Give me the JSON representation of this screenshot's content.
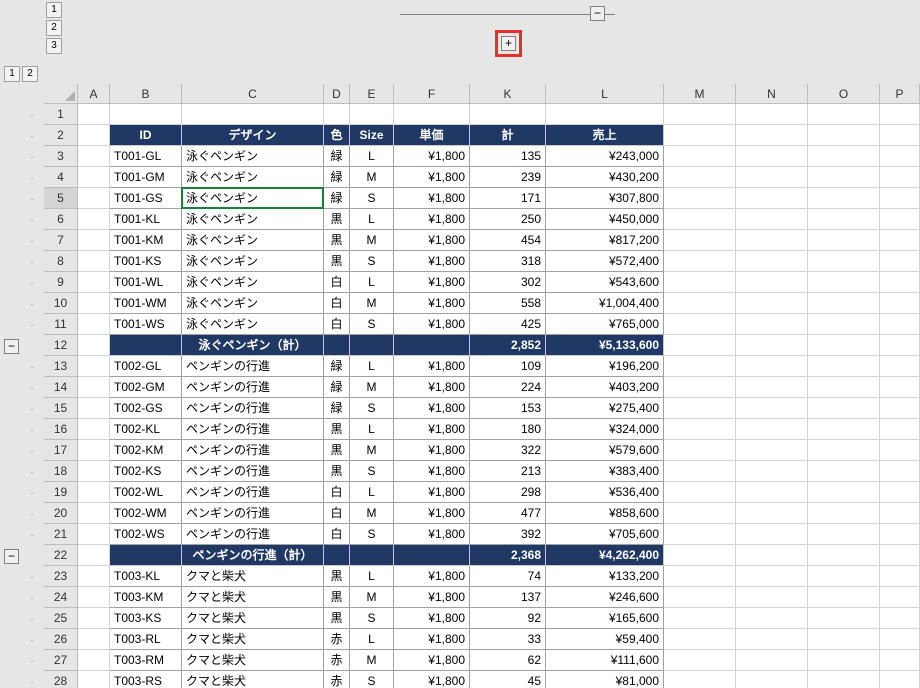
{
  "outline_row_levels": [
    "1",
    "2",
    "3"
  ],
  "outline_col_levels": [
    "1",
    "2"
  ],
  "col_group_minus": "−",
  "col_group_plus": "+",
  "row_group_minus": "−",
  "columns": {
    "A": "A",
    "B": "B",
    "C": "C",
    "D": "D",
    "E": "E",
    "F": "F",
    "K": "K",
    "L": "L",
    "M": "M",
    "N": "N",
    "O": "O",
    "P": "P"
  },
  "row_numbers": [
    "1",
    "2",
    "3",
    "4",
    "5",
    "6",
    "7",
    "8",
    "9",
    "10",
    "11",
    "12",
    "13",
    "14",
    "15",
    "16",
    "17",
    "18",
    "19",
    "20",
    "21",
    "22",
    "23",
    "24",
    "25",
    "26",
    "27",
    "28"
  ],
  "active_row": "5",
  "table": {
    "headers": {
      "B": "ID",
      "C": "デザイン",
      "D": "色",
      "E": "Size",
      "F": "単価",
      "K": "計",
      "L": "売上"
    },
    "rows": [
      {
        "B": "T001-GL",
        "C": "泳ぐペンギン",
        "D": "緑",
        "E": "L",
        "F": "¥1,800",
        "K": "135",
        "L": "¥243,000"
      },
      {
        "B": "T001-GM",
        "C": "泳ぐペンギン",
        "D": "緑",
        "E": "M",
        "F": "¥1,800",
        "K": "239",
        "L": "¥430,200"
      },
      {
        "B": "T001-GS",
        "C": "泳ぐペンギン",
        "D": "緑",
        "E": "S",
        "F": "¥1,800",
        "K": "171",
        "L": "¥307,800"
      },
      {
        "B": "T001-KL",
        "C": "泳ぐペンギン",
        "D": "黒",
        "E": "L",
        "F": "¥1,800",
        "K": "250",
        "L": "¥450,000"
      },
      {
        "B": "T001-KM",
        "C": "泳ぐペンギン",
        "D": "黒",
        "E": "M",
        "F": "¥1,800",
        "K": "454",
        "L": "¥817,200"
      },
      {
        "B": "T001-KS",
        "C": "泳ぐペンギン",
        "D": "黒",
        "E": "S",
        "F": "¥1,800",
        "K": "318",
        "L": "¥572,400"
      },
      {
        "B": "T001-WL",
        "C": "泳ぐペンギン",
        "D": "白",
        "E": "L",
        "F": "¥1,800",
        "K": "302",
        "L": "¥543,600"
      },
      {
        "B": "T001-WM",
        "C": "泳ぐペンギン",
        "D": "白",
        "E": "M",
        "F": "¥1,800",
        "K": "558",
        "L": "¥1,004,400"
      },
      {
        "B": "T001-WS",
        "C": "泳ぐペンギン",
        "D": "白",
        "E": "S",
        "F": "¥1,800",
        "K": "425",
        "L": "¥765,000"
      }
    ],
    "subtotal1": {
      "C": "泳ぐペンギン（計）",
      "K": "2,852",
      "L": "¥5,133,600"
    },
    "rows2": [
      {
        "B": "T002-GL",
        "C": "ペンギンの行進",
        "D": "緑",
        "E": "L",
        "F": "¥1,800",
        "K": "109",
        "L": "¥196,200"
      },
      {
        "B": "T002-GM",
        "C": "ペンギンの行進",
        "D": "緑",
        "E": "M",
        "F": "¥1,800",
        "K": "224",
        "L": "¥403,200"
      },
      {
        "B": "T002-GS",
        "C": "ペンギンの行進",
        "D": "緑",
        "E": "S",
        "F": "¥1,800",
        "K": "153",
        "L": "¥275,400"
      },
      {
        "B": "T002-KL",
        "C": "ペンギンの行進",
        "D": "黒",
        "E": "L",
        "F": "¥1,800",
        "K": "180",
        "L": "¥324,000"
      },
      {
        "B": "T002-KM",
        "C": "ペンギンの行進",
        "D": "黒",
        "E": "M",
        "F": "¥1,800",
        "K": "322",
        "L": "¥579,600"
      },
      {
        "B": "T002-KS",
        "C": "ペンギンの行進",
        "D": "黒",
        "E": "S",
        "F": "¥1,800",
        "K": "213",
        "L": "¥383,400"
      },
      {
        "B": "T002-WL",
        "C": "ペンギンの行進",
        "D": "白",
        "E": "L",
        "F": "¥1,800",
        "K": "298",
        "L": "¥536,400"
      },
      {
        "B": "T002-WM",
        "C": "ペンギンの行進",
        "D": "白",
        "E": "M",
        "F": "¥1,800",
        "K": "477",
        "L": "¥858,600"
      },
      {
        "B": "T002-WS",
        "C": "ペンギンの行進",
        "D": "白",
        "E": "S",
        "F": "¥1,800",
        "K": "392",
        "L": "¥705,600"
      }
    ],
    "subtotal2": {
      "C": "ペンギンの行進（計）",
      "K": "2,368",
      "L": "¥4,262,400"
    },
    "rows3": [
      {
        "B": "T003-KL",
        "C": "クマと柴犬",
        "D": "黒",
        "E": "L",
        "F": "¥1,800",
        "K": "74",
        "L": "¥133,200"
      },
      {
        "B": "T003-KM",
        "C": "クマと柴犬",
        "D": "黒",
        "E": "M",
        "F": "¥1,800",
        "K": "137",
        "L": "¥246,600"
      },
      {
        "B": "T003-KS",
        "C": "クマと柴犬",
        "D": "黒",
        "E": "S",
        "F": "¥1,800",
        "K": "92",
        "L": "¥165,600"
      },
      {
        "B": "T003-RL",
        "C": "クマと柴犬",
        "D": "赤",
        "E": "L",
        "F": "¥1,800",
        "K": "33",
        "L": "¥59,400"
      },
      {
        "B": "T003-RM",
        "C": "クマと柴犬",
        "D": "赤",
        "E": "M",
        "F": "¥1,800",
        "K": "62",
        "L": "¥111,600"
      },
      {
        "B": "T003-RS",
        "C": "クマと柴犬",
        "D": "赤",
        "E": "S",
        "F": "¥1,800",
        "K": "45",
        "L": "¥81,000"
      }
    ]
  }
}
